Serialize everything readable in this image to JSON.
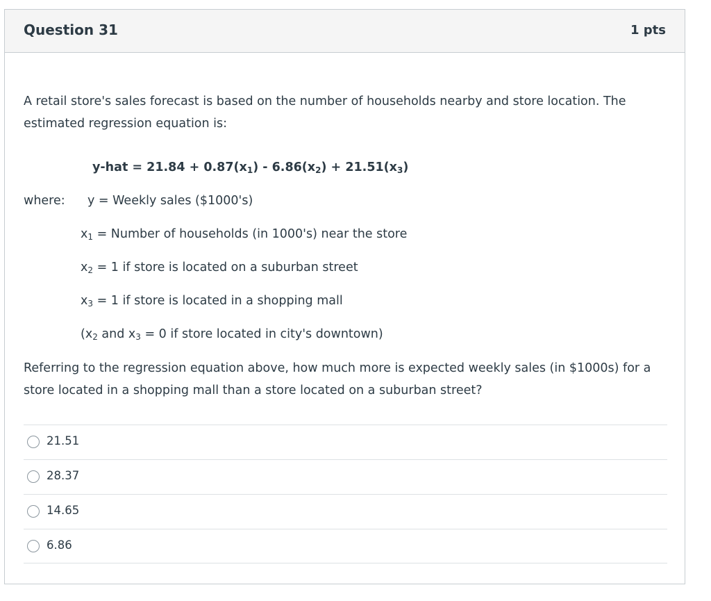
{
  "question": {
    "title": "Question 31",
    "points": "1 pts",
    "intro": "A retail store's sales forecast is based on the number of households nearby and store location. The estimated regression equation is:",
    "equation": {
      "p1": "y-hat = 21.84 + 0.87(x",
      "p2": ") - 6.86(x",
      "p3": ") + 21.51(x",
      "p4": ")",
      "s1": "1",
      "s2": "2",
      "s3": "3"
    },
    "where_label": "where:",
    "y_def": "y = Weekly sales ($1000's)",
    "x1_def": {
      "var": "x",
      "sub": "1",
      "text": " = Number of households (in 1000's) near the store"
    },
    "x2_def": {
      "var": "x",
      "sub": "2",
      "text": " = 1 if store is located on a suburban street"
    },
    "x3_def": {
      "var": "x",
      "sub": "3",
      "text": " = 1 if store is located in a shopping mall"
    },
    "note": {
      "p1": "(x",
      "s1": "2",
      "p2": " and x",
      "s2": "3",
      "p3": " = 0 if store located in city's downtown)"
    },
    "prompt": "Referring to the regression equation above, how much more is expected weekly sales (in $1000s) for a store located in a shopping mall than a store located on a suburban street?"
  },
  "answers": [
    {
      "label": "21.51"
    },
    {
      "label": "28.37"
    },
    {
      "label": "14.65"
    },
    {
      "label": "6.86"
    }
  ]
}
